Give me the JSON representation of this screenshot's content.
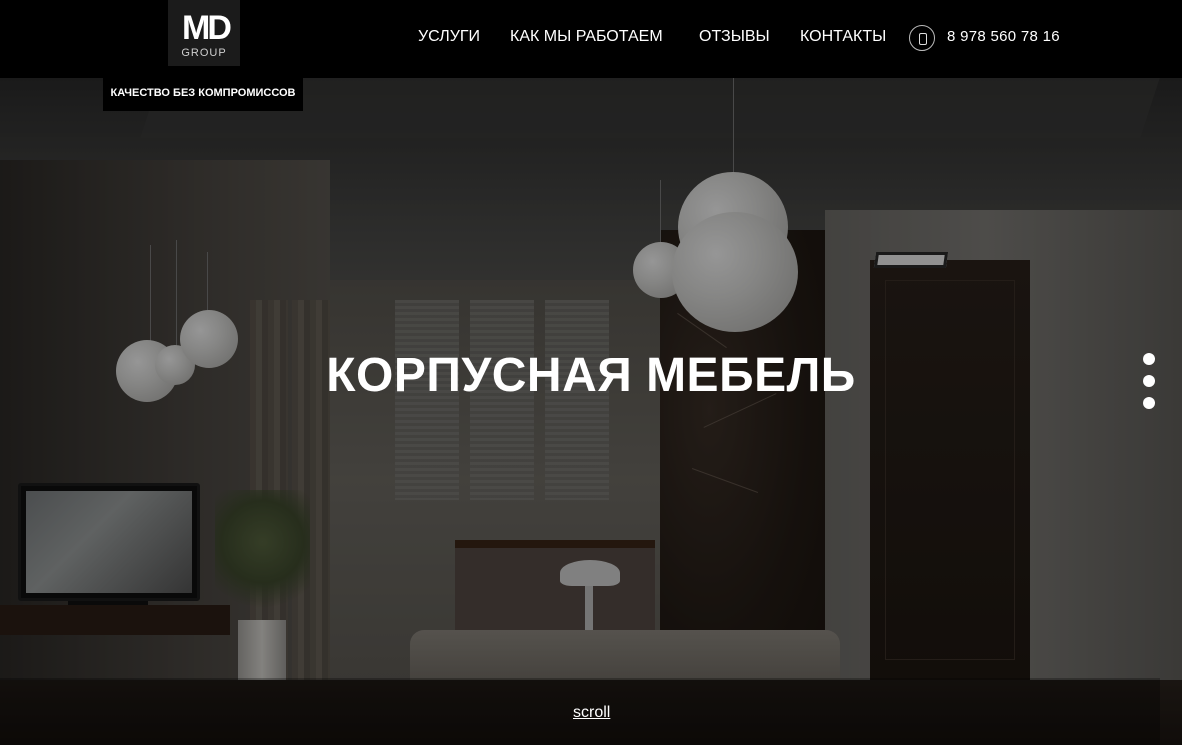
{
  "brand": {
    "logo_letters": "MD",
    "logo_sub": "GROUP",
    "tagline": "КАЧЕСТВО БЕЗ КОМПРОМИССОВ"
  },
  "nav": {
    "items": [
      {
        "label": "УСЛУГИ"
      },
      {
        "label": "КАК МЫ РАБОТАЕМ"
      },
      {
        "label": "ОТЗЫВЫ"
      },
      {
        "label": "КОНТАКТЫ"
      }
    ],
    "phone_icon": "phone-icon",
    "phone": "8 978 560 78 16"
  },
  "hero": {
    "title": "КОРПУСНАЯ МЕБЕЛЬ",
    "slides_count": 3,
    "scroll_label": "scroll"
  },
  "colors": {
    "header_bg": "#000000",
    "text": "#ffffff"
  }
}
